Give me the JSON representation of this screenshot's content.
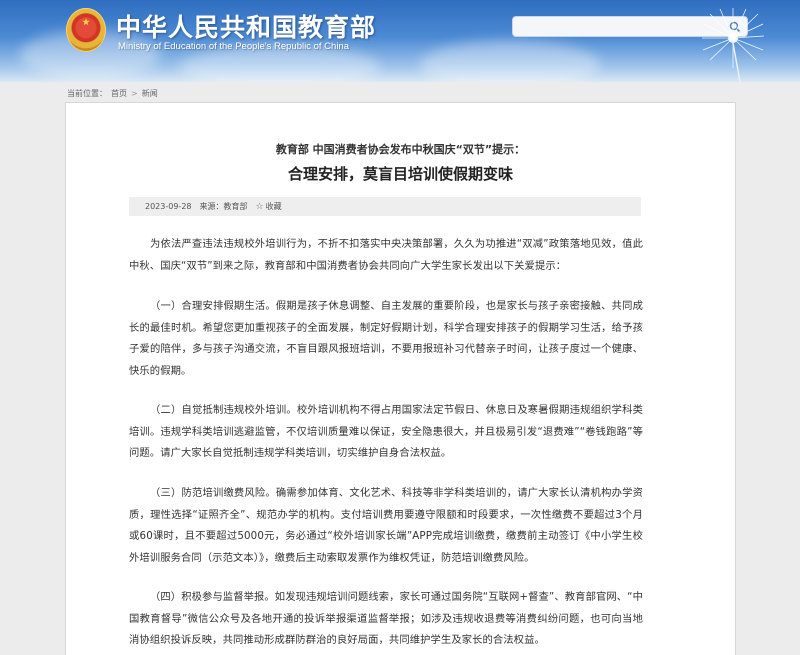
{
  "header": {
    "title": "中华人民共和国教育部",
    "subtitle": "Ministry of Education of the People's Republic of China",
    "search_placeholder": ""
  },
  "breadcrumb": {
    "label": "当前位置：",
    "items": [
      "首页",
      "新闻"
    ],
    "separator": ">"
  },
  "article": {
    "pre_title": "教育部 中国消费者协会发布中秋国庆“双节”提示：",
    "title": "合理安排，莫盲目培训使假期变味",
    "date": "2023-09-28",
    "source": "来源：教育部",
    "favorite": "收藏",
    "paragraphs": [
      "为依法严查违法违规校外培训行为，不折不扣落实中央决策部署，久久为功推进“双减”政策落地见效，值此中秋、国庆“双节”到来之际，教育部和中国消费者协会共同向广大学生家长发出以下关爱提示：",
      "（一）合理安排假期生活。假期是孩子休息调整、自主发展的重要阶段，也是家长与孩子亲密接触、共同成长的最佳时机。希望您更加重视孩子的全面发展，制定好假期计划，科学合理安排孩子的假期学习生活，给予孩子爱的陪伴，多与孩子沟通交流，不盲目跟风报班培训，不要用报班补习代替亲子时间，让孩子度过一个健康、快乐的假期。",
      "（二）自觉抵制违规校外培训。校外培训机构不得占用国家法定节假日、休息日及寒暑假期违规组织学科类培训。违规学科类培训逃避监管，不仅培训质量难以保证，安全隐患很大，并且极易引发“退费难”“卷钱跑路”等问题。请广大家长自觉抵制违规学科类培训，切实维护自身合法权益。",
      "（三）防范培训缴费风险。确需参加体育、文化艺术、科技等非学科类培训的，请广大家长认清机构办学资质，理性选择“证照齐全”、规范办学的机构。支付培训费用要遵守限额和时段要求，一次性缴费不要超过3个月或60课时，且不要超过5000元，务必通过“校外培训家长端”APP完成培训缴费，缴费前主动签订《中小学生校外培训服务合同（示范文本）》，缴费后主动索取发票作为维权凭证，防范培训缴费风险。",
      "（四）积极参与监督举报。如发现违规培训问题线索，家长可通过国务院“互联网+督查”、教育部官网、“中国教育督导”微信公众号及各地开通的投诉举报渠道监督举报；如涉及违规收退费等消费纠纷问题，也可向当地消协组织投诉反映，共同推动形成群防群治的良好局面，共同维护学生及家长的合法权益。"
    ]
  },
  "colors": {
    "header_blue": "#2f6ec0",
    "page_bg": "#ececec",
    "meta_bar_bg": "#eeeeee"
  },
  "icons": [
    "national-emblem-icon",
    "search-icon",
    "dandelion-decoration",
    "star-icon"
  ]
}
